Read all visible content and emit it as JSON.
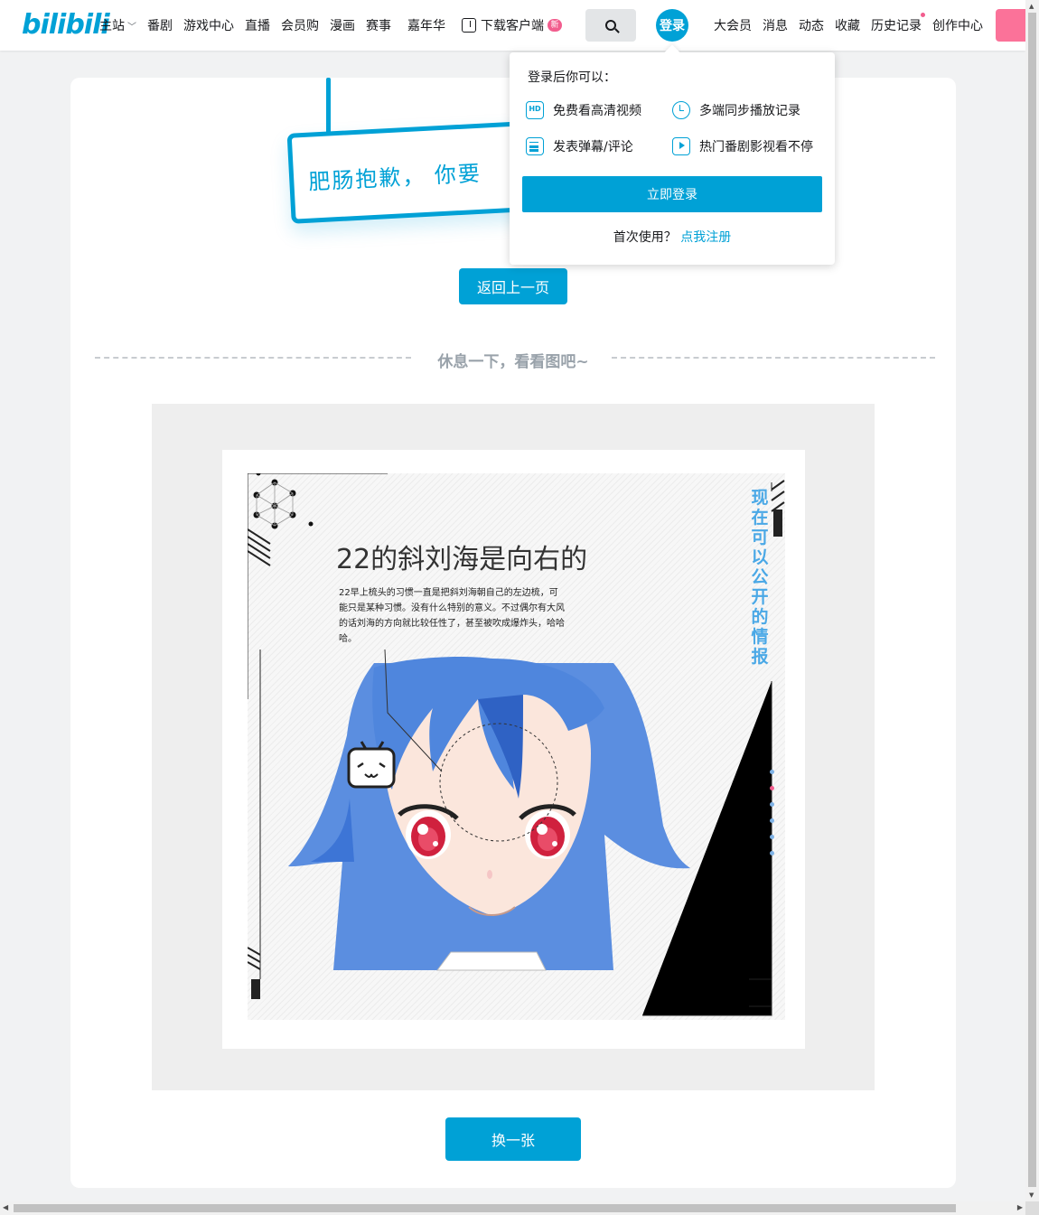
{
  "header": {
    "logo_text": "bilibili",
    "nav_left": [
      {
        "label": "主站",
        "dropdown": true
      },
      {
        "label": "番剧"
      },
      {
        "label": "游戏中心"
      },
      {
        "label": "直播"
      },
      {
        "label": "会员购"
      },
      {
        "label": "漫画"
      },
      {
        "label": "赛事"
      },
      {
        "label": "嘉年华"
      },
      {
        "label": "下载客户端",
        "badge": "新"
      }
    ],
    "search_icon": "search-icon",
    "login_label": "登录",
    "nav_right": [
      {
        "label": "大会员"
      },
      {
        "label": "消息"
      },
      {
        "label": "动态"
      },
      {
        "label": "收藏"
      },
      {
        "label": "历史记录",
        "dot": true
      },
      {
        "label": "创作中心"
      }
    ],
    "accent": "#00a1d6",
    "pink": "#fb7299"
  },
  "error": {
    "sign_text": "肥肠抱歉， 你要",
    "back_label": "返回上一页",
    "divider_text": "休息一下，看看图吧~"
  },
  "picture": {
    "title": "22的斜刘海是向右的",
    "description": "22早上梳头的习惯一直是把斜刘海朝自己的左边梳，可能只是某种习惯。没有什么特别的意义。不过偶尔有大风的话刘海的方向就比较任性了，甚至被吹成爆炸头，哈哈哈。",
    "vertical_text": "现在可以公开的情报",
    "next_label": "换一张"
  },
  "popover": {
    "title": "登录后你可以：",
    "features": [
      {
        "label": "免费看高清视频",
        "icon": "hd-icon",
        "icon_text": "HD"
      },
      {
        "label": "多端同步播放记录",
        "icon": "clock-icon"
      },
      {
        "label": "发表弹幕/评论",
        "icon": "danmaku-icon"
      },
      {
        "label": "热门番剧影视看不停",
        "icon": "play-icon"
      }
    ],
    "login_button": "立即登录",
    "first_use": "首次使用？",
    "register_link": "点我注册"
  }
}
